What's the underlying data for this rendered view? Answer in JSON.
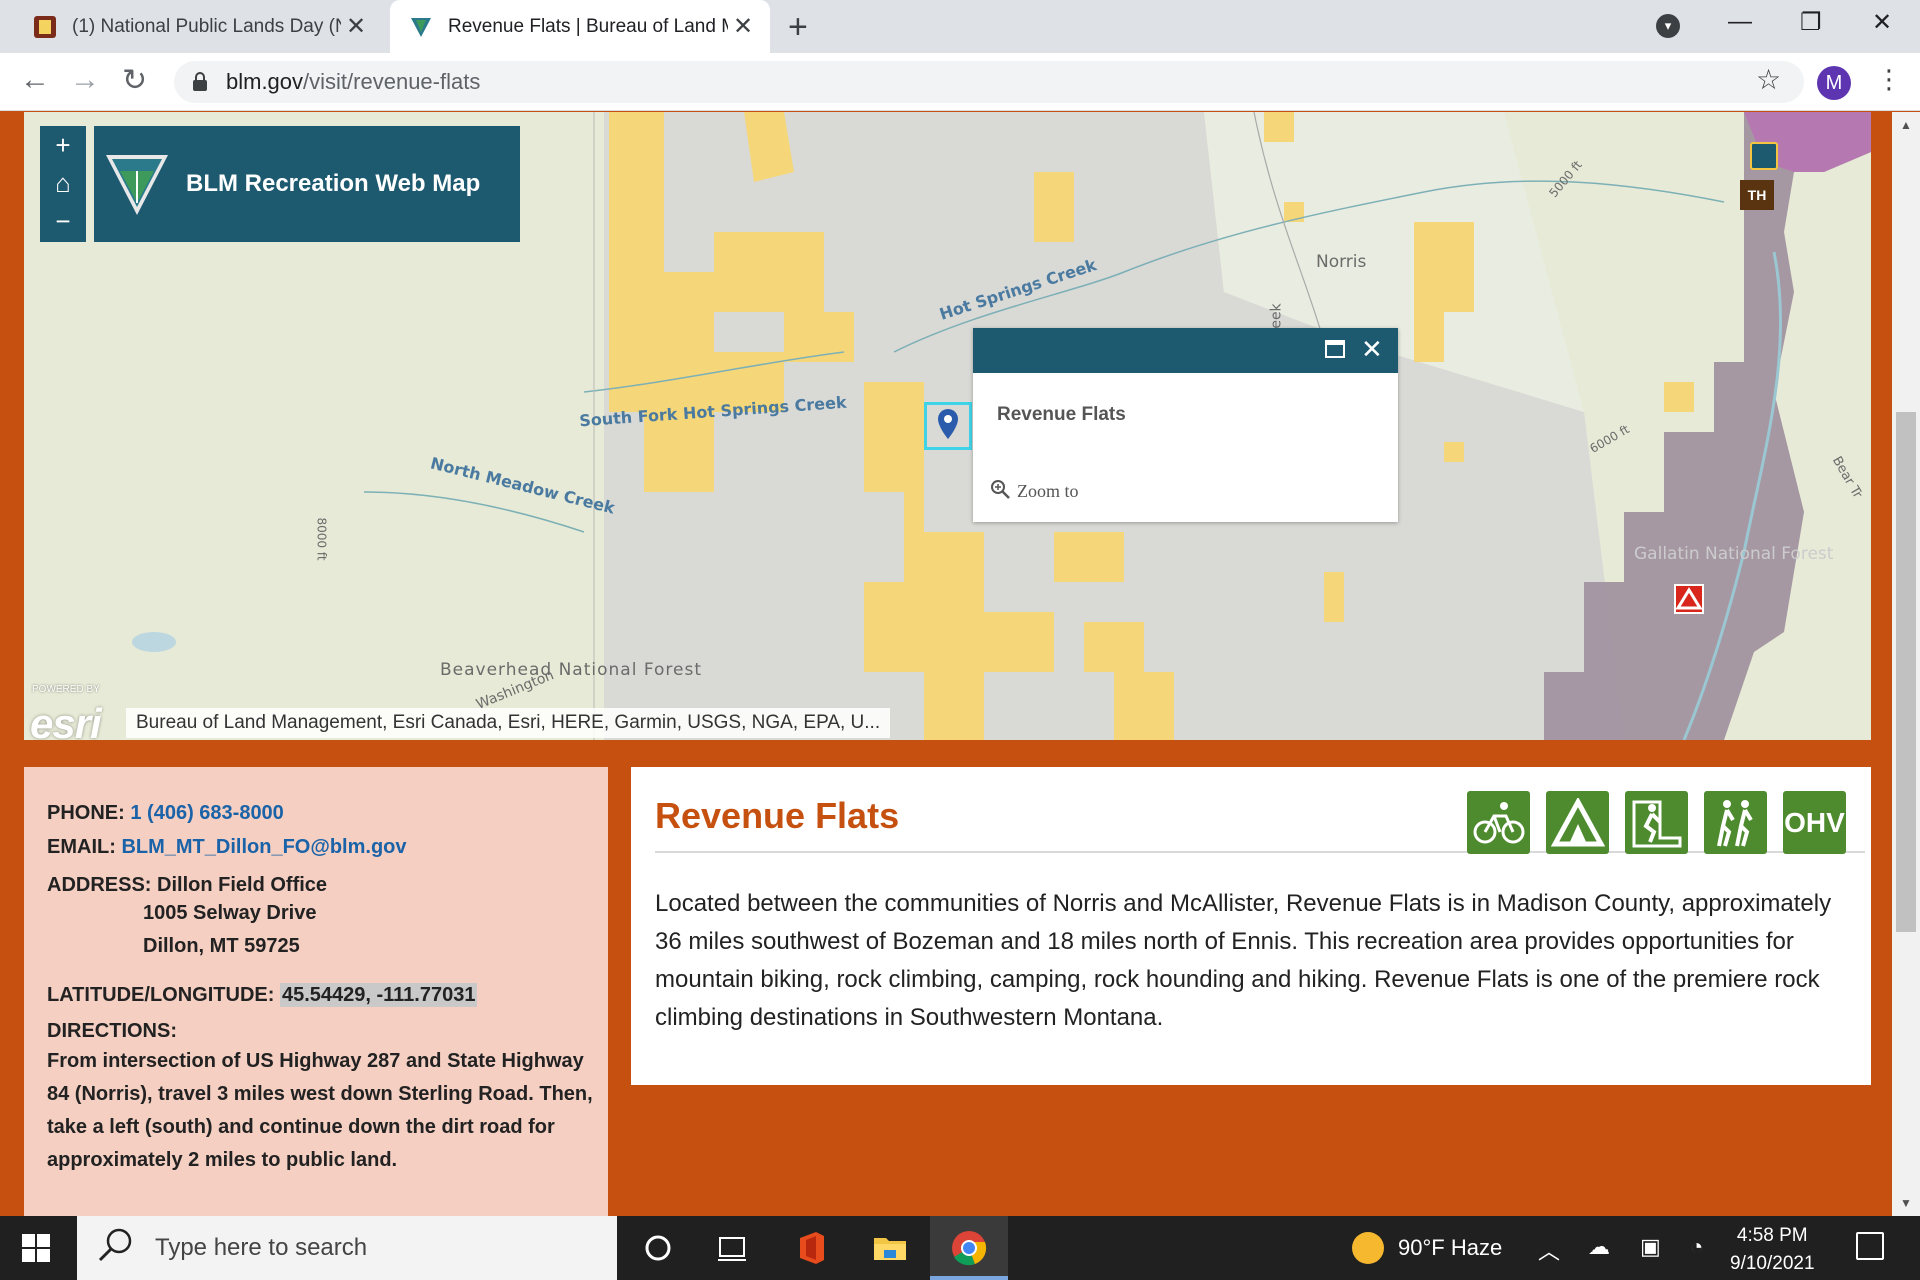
{
  "browser": {
    "tabs": [
      {
        "title": "(1) National Public Lands Day (NP",
        "active": false
      },
      {
        "title": "Revenue Flats | Bureau of Land M",
        "active": true
      }
    ],
    "url_host": "blm.gov",
    "url_path": "/visit/revenue-flats",
    "profile_initial": "M"
  },
  "map": {
    "title": "BLM Recreation Web Map",
    "zoom_in": "+",
    "home": "⌂",
    "zoom_out": "−",
    "labels": {
      "norris": "Norris",
      "hot_springs_creek": "Hot Springs Creek",
      "south_fork": "South Fork Hot Springs Creek",
      "north_meadow": "North Meadow Creek",
      "beaverhead": "Beaverhead National Forest",
      "washington": "Washington",
      "gallatin": "Gallatin National Forest",
      "bear_tr": "Bear Tr",
      "elev_5000": "5000 ft",
      "elev_6000": "6000 ft",
      "elev_8000": "8000 ft",
      "eek": "eek",
      "th_sign": "TH"
    },
    "attribution": "Bureau of Land Management, Esri Canada, Esri, HERE, Garmin, USGS, NGA, EPA, U...",
    "esri_powered": "POWERED BY",
    "esri": "esri",
    "popup": {
      "title": "Revenue Flats",
      "zoom_to": "Zoom to"
    }
  },
  "contact": {
    "phone_label": "PHONE:",
    "phone": "1 (406) 683-8000",
    "email_label": "EMAIL:",
    "email": "BLM_MT_Dillon_FO@blm.gov",
    "address_label": "ADDRESS:",
    "address_line1": "Dillon Field Office",
    "address_line2": "1005 Selway Drive",
    "address_line3": "Dillon, MT 59725",
    "latlong_label": "LATITUDE/LONGITUDE:",
    "latlong": "45.54429, -111.77031",
    "directions_label": "DIRECTIONS:",
    "directions": "From intersection of US Highway 287 and State Highway 84 (Norris), travel 3 miles west down Sterling Road. Then, take a left (south) and continue down the dirt road for approximately 2 miles to public land."
  },
  "description": {
    "title": "Revenue Flats",
    "body": "Located between the communities of Norris and McAllister, Revenue Flats is in Madison County, approximately 36 miles southwest of Bozeman and 18 miles north of Ennis. This recreation area provides opportunities for mountain biking, rock climbing, camping, rock hounding and hiking. Revenue Flats is one of the premiere rock climbing destinations in Southwestern Montana.",
    "activities": [
      "mountain-biking-icon",
      "camping-icon",
      "rock-climbing-icon",
      "hiking-icon",
      "ohv-icon"
    ],
    "ohv_label": "OHV"
  },
  "taskbar": {
    "search_placeholder": "Type here to search",
    "weather": "90°F  Haze",
    "time": "4:58 PM",
    "date": "9/10/2021"
  },
  "colors": {
    "page_bg": "#c5500f",
    "map_header": "#1d5a70",
    "activity_green": "#4e8a2e",
    "contact_bg": "#f4cfc2",
    "link_blue": "#1a63a8"
  }
}
